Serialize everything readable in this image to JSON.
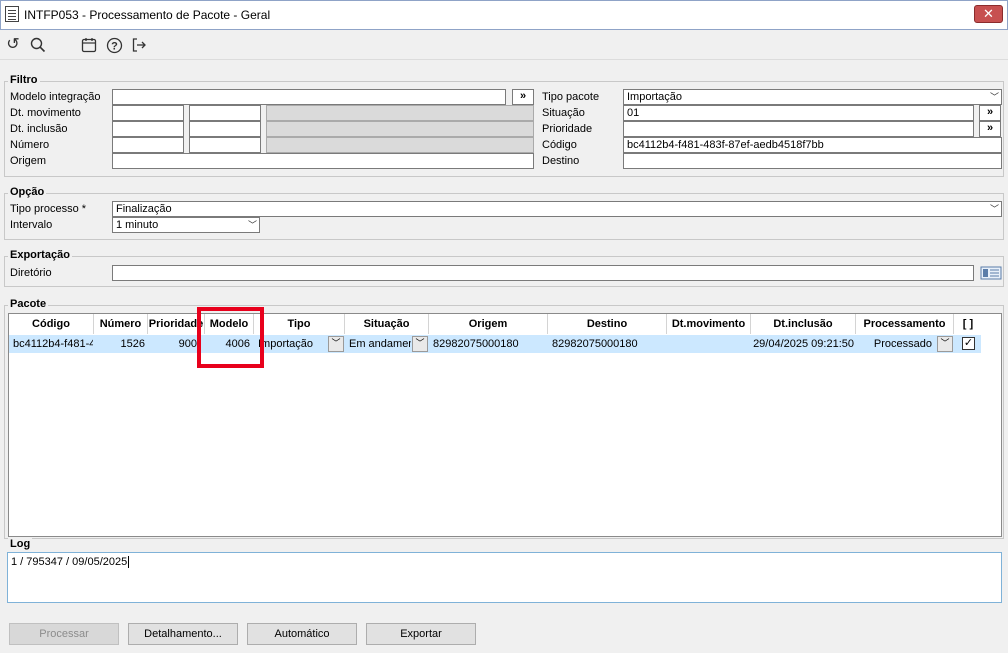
{
  "window": {
    "title": "INTFP053 - Processamento de Pacote - Geral",
    "close": "✕"
  },
  "toolbar": {
    "icons": [
      "undo-icon",
      "search-icon",
      "calendar-icon",
      "help-icon",
      "exit-icon"
    ],
    "undo": "↺",
    "search": "⚲",
    "calendar": "▦",
    "help": "?",
    "exit": "↦"
  },
  "filtro": {
    "title": "Filtro",
    "modelo_integracao": {
      "label": "Modelo integração",
      "value": "",
      "btn": "»"
    },
    "dt_movimento": {
      "label": "Dt. movimento",
      "from": "",
      "to": ""
    },
    "dt_inclusao": {
      "label": "Dt. inclusão",
      "from": "",
      "to": ""
    },
    "numero": {
      "label": "Número",
      "from": "",
      "to": ""
    },
    "origem": {
      "label": "Origem",
      "value": ""
    },
    "tipo_pacote": {
      "label": "Tipo pacote",
      "value": "Importação"
    },
    "situacao": {
      "label": "Situação",
      "value": "01",
      "btn": "»"
    },
    "prioridade": {
      "label": "Prioridade",
      "value": "",
      "btn": "»"
    },
    "codigo": {
      "label": "Código",
      "value": "bc4112b4-f481-483f-87ef-aedb4518f7bb"
    },
    "destino": {
      "label": "Destino",
      "value": ""
    }
  },
  "opcao": {
    "title": "Opção",
    "tipo_processo": {
      "label": "Tipo processo *",
      "value": "Finalização"
    },
    "intervalo": {
      "label": "Intervalo",
      "value": "1 minuto"
    }
  },
  "exportacao": {
    "title": "Exportação",
    "diretorio": {
      "label": "Diretório",
      "value": ""
    }
  },
  "pacote": {
    "title": "Pacote",
    "columns": [
      "Código",
      "Número",
      "Prioridade",
      "Modelo",
      "Tipo",
      "Situação",
      "Origem",
      "Destino",
      "Dt.movimento",
      "Dt.inclusão",
      "Processamento",
      "[ ]"
    ],
    "rows": [
      {
        "codigo": "bc4112b4-f481-4",
        "numero": "1526",
        "prioridade": "900",
        "modelo": "4006",
        "tipo": "Importação",
        "situacao": "Em andamento",
        "origem": "82982075000180",
        "destino": "82982075000180",
        "dt_movimento": "",
        "dt_inclusao": "29/04/2025 09:21:50",
        "processamento": "Processado",
        "checked": "✓"
      }
    ]
  },
  "log": {
    "title": "Log",
    "text": "1 / 795347 / 09/05/2025"
  },
  "buttons": {
    "processar": "Processar",
    "detalhamento": "Detalhamento...",
    "automatico": "Automático",
    "exportar": "Exportar"
  },
  "colors": {
    "highlight": "#e8001c",
    "selected_row": "#cce8ff"
  }
}
